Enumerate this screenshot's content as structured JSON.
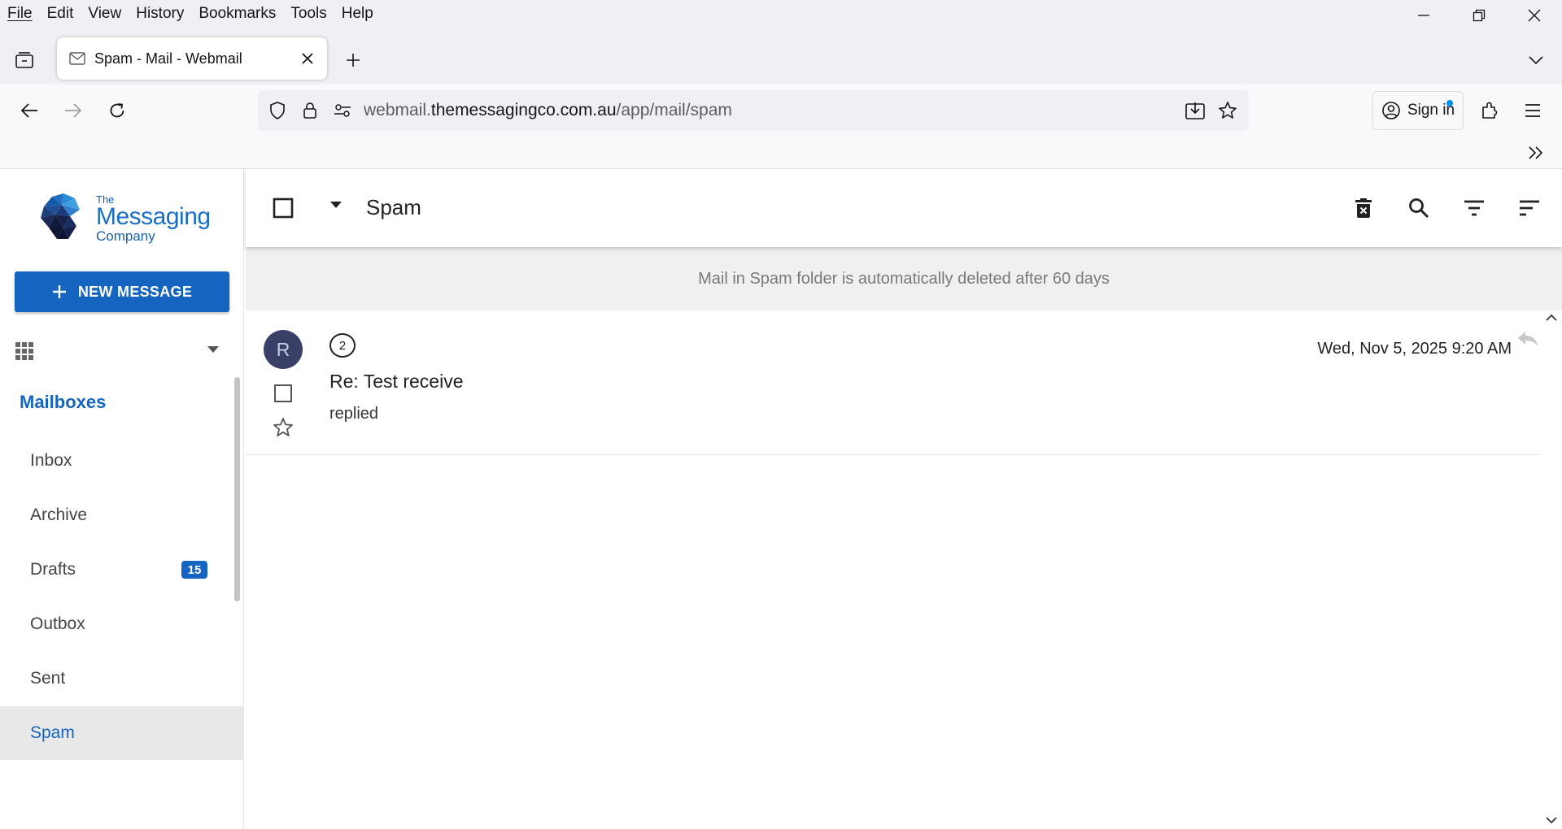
{
  "browser": {
    "menu": [
      "File",
      "Edit",
      "View",
      "History",
      "Bookmarks",
      "Tools",
      "Help"
    ],
    "tab": {
      "title": "Spam - Mail - Webmail",
      "favicon": "mail-icon"
    },
    "url": {
      "prefix": "webmail.",
      "domain": "themessagingco.com.au",
      "path": "/app/mail/spam"
    },
    "signin_label": "Sign in"
  },
  "app": {
    "logo": {
      "the": "The",
      "messaging": "Messaging",
      "company": "Company"
    },
    "new_message_label": "NEW MESSAGE",
    "mailboxes_title": "Mailboxes",
    "folders": [
      {
        "label": "Inbox",
        "badge": null,
        "active": false
      },
      {
        "label": "Archive",
        "badge": null,
        "active": false
      },
      {
        "label": "Drafts",
        "badge": "15",
        "active": false
      },
      {
        "label": "Outbox",
        "badge": null,
        "active": false
      },
      {
        "label": "Sent",
        "badge": null,
        "active": false
      },
      {
        "label": "Spam",
        "badge": null,
        "active": true
      }
    ],
    "accent_color": "#1565c0"
  },
  "main": {
    "folder_title": "Spam",
    "notice": "Mail in Spam folder is automatically deleted after 60 days",
    "messages": [
      {
        "avatar_initial": "R",
        "thread_count": "2",
        "subject": "Re: Test receive",
        "snippet": "replied",
        "date": "Wed, Nov 5, 2025 9:20 AM"
      }
    ]
  }
}
